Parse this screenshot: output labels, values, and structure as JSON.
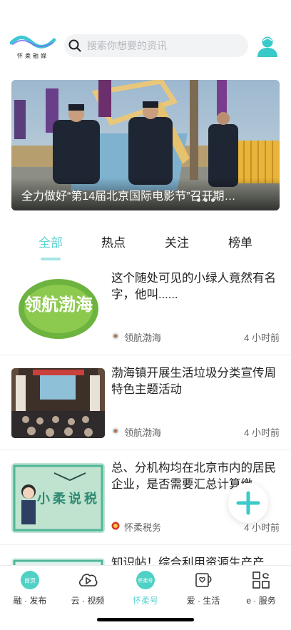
{
  "header": {
    "logo_text": "怀柔融媒",
    "search_placeholder": "搜索你想要的资讯",
    "icons": {
      "search": "search-icon",
      "user": "user-icon"
    }
  },
  "banner": {
    "caption": "全力做好“第14届北京国际电影节”召开期…",
    "slide_count": 3
  },
  "tabs": [
    {
      "label": "全部",
      "active": true
    },
    {
      "label": "热点",
      "active": false
    },
    {
      "label": "关注",
      "active": false
    },
    {
      "label": "榜单",
      "active": false
    }
  ],
  "news": [
    {
      "title": "这个随处可见的小绿人竟然有名字，他叫......",
      "source": "领航渤海",
      "time": "4 小时前",
      "thumb_text": "领航渤海"
    },
    {
      "title": "渤海镇开展生活垃圾分类宣传周特色主题活动",
      "source": "领航渤海",
      "time": "4 小时前"
    },
    {
      "title": "总、分机构均在北京市内的居民企业，是否需要汇总计算缴",
      "source": "怀柔税务",
      "time": "4 小时前",
      "thumb_text": "小柔说税"
    },
    {
      "title": "知识帖！综合利用资源生产产"
    }
  ],
  "bottom_nav": [
    {
      "label": "融 · 发布",
      "icon": "home-icon",
      "badge": "首页",
      "active": false
    },
    {
      "label": "云 · 视频",
      "icon": "video-cloud-icon",
      "active": false
    },
    {
      "label": "怀柔号",
      "icon": "huairou-account-icon",
      "badge": "怀柔号",
      "active": true
    },
    {
      "label": "爱 · 生活",
      "icon": "life-mug-icon",
      "active": false
    },
    {
      "label": "e · 服务",
      "icon": "service-grid-icon",
      "active": false
    }
  ],
  "colors": {
    "accent": "#5ed3d3",
    "text": "#222222",
    "muted": "#666666"
  }
}
